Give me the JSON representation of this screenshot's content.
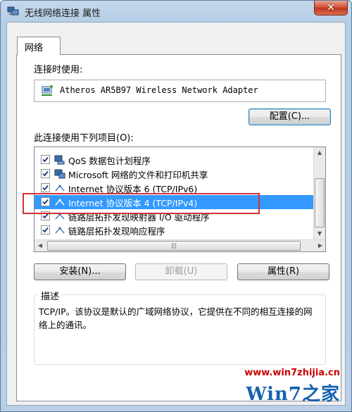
{
  "window": {
    "title": "无线网络连接 属性",
    "close_label": "✕"
  },
  "tabs": [
    {
      "label": "网络"
    }
  ],
  "connect_using": {
    "label": "连接时使用:",
    "adapter": "Atheros AR5B97 Wireless Network Adapter",
    "configure_label": "配置(C)..."
  },
  "items_section": {
    "label": "此连接使用下列项目(O):",
    "items": [
      {
        "label": "QoS 数据包计划程序",
        "checked": true,
        "icon": "qos-icon"
      },
      {
        "label": "Microsoft 网络的文件和打印机共享",
        "checked": true,
        "icon": "file-share-icon"
      },
      {
        "label": "Internet 协议版本 6 (TCP/IPv6)",
        "checked": true,
        "icon": "protocol-icon"
      },
      {
        "label": "Internet 协议版本 4 (TCP/IPv4)",
        "checked": true,
        "icon": "protocol-icon",
        "selected": true
      },
      {
        "label": "链路层拓扑发现映射器 I/O 驱动程序",
        "checked": true,
        "icon": "protocol-icon"
      },
      {
        "label": "链路层拓扑发现响应程序",
        "checked": true,
        "icon": "protocol-icon"
      }
    ],
    "hscroll_grip": "|||"
  },
  "buttons": {
    "install": "安装(N)...",
    "uninstall": "卸载(U)",
    "properties": "属性(R)"
  },
  "description": {
    "title": "描述",
    "text": "TCP/IP。该协议是默认的广域网络协议，它提供在不同的相互连接的网络上的通讯。"
  },
  "watermark": {
    "url": "www.win7zhijia.cn",
    "logo": "Win7之家"
  },
  "colors": {
    "selection": "#3399ff",
    "highlight_box": "#d3303a",
    "watermark_url": "#cc0000"
  }
}
